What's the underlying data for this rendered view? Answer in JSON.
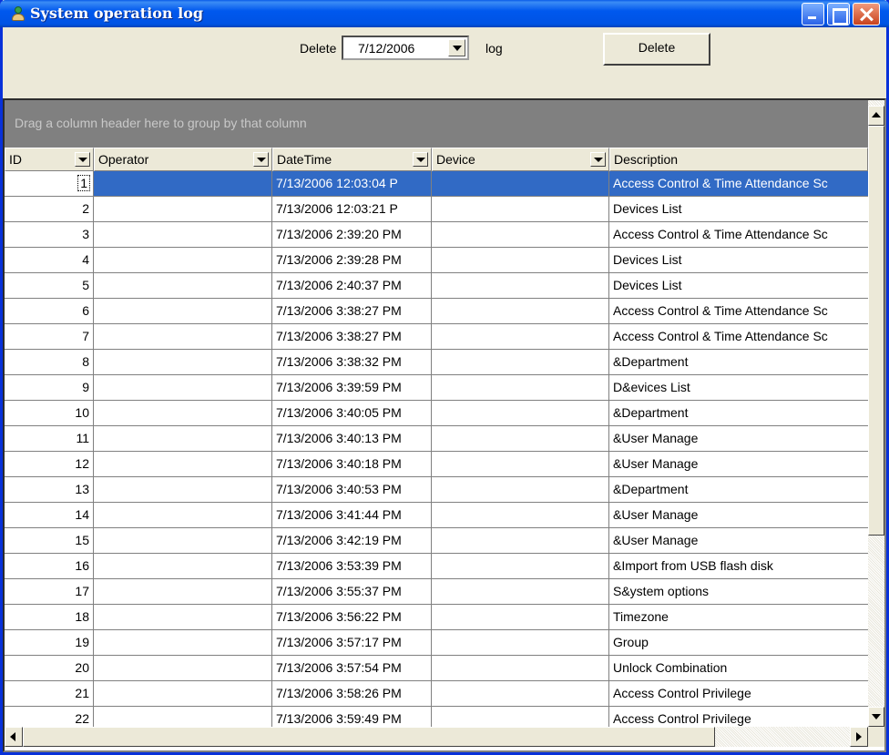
{
  "window": {
    "title": "System operation log",
    "icon": "person-icon"
  },
  "toolbar": {
    "delete_label": "Delete",
    "date_value": "7/12/2006",
    "log_label": "log",
    "delete_button": "Delete"
  },
  "grid": {
    "group_hint": "Drag a column header here to group by that column",
    "columns": [
      "ID",
      "Operator",
      "DateTime",
      "Device",
      "Description"
    ],
    "selected_row": 0,
    "rows": [
      {
        "id": "1",
        "operator": "",
        "datetime": "7/13/2006 12:03:04 P",
        "device": "",
        "description": "Access Control & Time Attendance Sc"
      },
      {
        "id": "2",
        "operator": "",
        "datetime": "7/13/2006 12:03:21 P",
        "device": "",
        "description": "Devices List"
      },
      {
        "id": "3",
        "operator": "",
        "datetime": "7/13/2006 2:39:20 PM",
        "device": "",
        "description": "Access Control & Time Attendance Sc"
      },
      {
        "id": "4",
        "operator": "",
        "datetime": "7/13/2006 2:39:28 PM",
        "device": "",
        "description": "Devices List"
      },
      {
        "id": "5",
        "operator": "",
        "datetime": "7/13/2006 2:40:37 PM",
        "device": "",
        "description": "Devices List"
      },
      {
        "id": "6",
        "operator": "",
        "datetime": "7/13/2006 3:38:27 PM",
        "device": "",
        "description": "Access Control & Time Attendance Sc"
      },
      {
        "id": "7",
        "operator": "",
        "datetime": "7/13/2006 3:38:27 PM",
        "device": "",
        "description": "Access Control & Time Attendance Sc"
      },
      {
        "id": "8",
        "operator": "",
        "datetime": "7/13/2006 3:38:32 PM",
        "device": "",
        "description": "&Department"
      },
      {
        "id": "9",
        "operator": "",
        "datetime": "7/13/2006 3:39:59 PM",
        "device": "",
        "description": "D&evices List"
      },
      {
        "id": "10",
        "operator": "",
        "datetime": "7/13/2006 3:40:05 PM",
        "device": "",
        "description": "&Department"
      },
      {
        "id": "11",
        "operator": "",
        "datetime": "7/13/2006 3:40:13 PM",
        "device": "",
        "description": "&User Manage"
      },
      {
        "id": "12",
        "operator": "",
        "datetime": "7/13/2006 3:40:18 PM",
        "device": "",
        "description": "&User Manage"
      },
      {
        "id": "13",
        "operator": "",
        "datetime": "7/13/2006 3:40:53 PM",
        "device": "",
        "description": "&Department"
      },
      {
        "id": "14",
        "operator": "",
        "datetime": "7/13/2006 3:41:44 PM",
        "device": "",
        "description": "&User Manage"
      },
      {
        "id": "15",
        "operator": "",
        "datetime": "7/13/2006 3:42:19 PM",
        "device": "",
        "description": "&User Manage"
      },
      {
        "id": "16",
        "operator": "",
        "datetime": "7/13/2006 3:53:39 PM",
        "device": "",
        "description": "&Import from USB flash disk"
      },
      {
        "id": "17",
        "operator": "",
        "datetime": "7/13/2006 3:55:37 PM",
        "device": "",
        "description": "S&ystem options"
      },
      {
        "id": "18",
        "operator": "",
        "datetime": "7/13/2006 3:56:22 PM",
        "device": "",
        "description": "Timezone"
      },
      {
        "id": "19",
        "operator": "",
        "datetime": "7/13/2006 3:57:17 PM",
        "device": "",
        "description": "Group"
      },
      {
        "id": "20",
        "operator": "",
        "datetime": "7/13/2006 3:57:54 PM",
        "device": "",
        "description": "Unlock Combination"
      },
      {
        "id": "21",
        "operator": "",
        "datetime": "7/13/2006 3:58:26 PM",
        "device": "",
        "description": "Access Control Privilege"
      },
      {
        "id": "22",
        "operator": "",
        "datetime": "7/13/2006 3:59:49 PM",
        "device": "",
        "description": "Access Control Privilege"
      }
    ]
  }
}
